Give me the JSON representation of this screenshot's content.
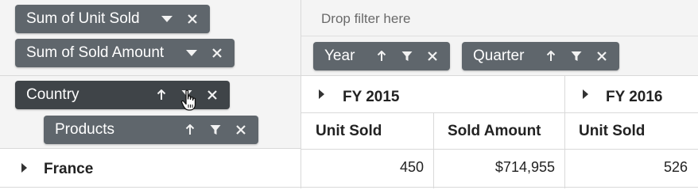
{
  "values_area": {
    "chips": [
      {
        "label": "Sum of Unit Sold"
      },
      {
        "label": "Sum of Sold Amount"
      }
    ]
  },
  "filter_area": {
    "placeholder": "Drop filter here"
  },
  "columns_area": {
    "chips": [
      {
        "label": "Year"
      },
      {
        "label": "Quarter"
      }
    ]
  },
  "rows_area": {
    "chips": [
      {
        "label": "Country"
      },
      {
        "label": "Products"
      }
    ]
  },
  "grid": {
    "column_groups": [
      {
        "label": "FY 2015"
      },
      {
        "label": "FY 2016"
      }
    ],
    "measure_headers": [
      "Unit Sold",
      "Sold Amount",
      "Unit Sold"
    ],
    "rows": [
      {
        "label": "France",
        "cells": [
          "450",
          "$714,955",
          "526"
        ]
      }
    ]
  },
  "colors": {
    "chip_bg": "#5f666c",
    "chip_active_bg": "#3f4448",
    "pane_bg": "#f4f4f4",
    "border": "#d9d9d9"
  }
}
